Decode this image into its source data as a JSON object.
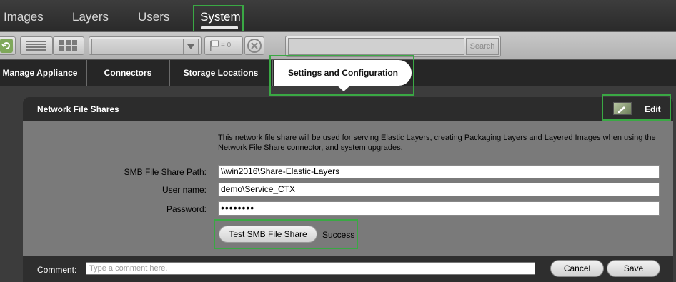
{
  "nav": {
    "tabs": [
      {
        "label": "Images"
      },
      {
        "label": "Layers"
      },
      {
        "label": "Users"
      },
      {
        "label": "System",
        "active": true
      }
    ]
  },
  "toolbar": {
    "flag_count": "= 0",
    "search_label": "Search",
    "search_value": ""
  },
  "subtabs": [
    {
      "label": "Manage Appliance"
    },
    {
      "label": "Connectors"
    },
    {
      "label": "Storage Locations"
    },
    {
      "label": "Settings and Configuration",
      "active": true
    }
  ],
  "panel": {
    "title": "Network File Shares",
    "edit_label": "Edit",
    "description": "This network file share will be used for serving Elastic Layers, creating Packaging Layers and Layered Images when using the Network File Share connector, and system upgrades.",
    "fields": {
      "smb_path_label": "SMB File Share Path:",
      "smb_path_value": "\\\\win2016\\Share-Elastic-Layers",
      "username_label": "User name:",
      "username_value": "demo\\Service_CTX",
      "password_label": "Password:",
      "password_value": "••••••••"
    },
    "test_button": "Test SMB File Share",
    "test_status": "Success"
  },
  "footer": {
    "comment_label": "Comment:",
    "comment_placeholder": "Type a comment here.",
    "cancel_label": "Cancel",
    "save_label": "Save"
  },
  "colors": {
    "highlight": "#3aa844",
    "panel_bg": "#7a7a7a",
    "header_bg": "#2c2c2c"
  }
}
